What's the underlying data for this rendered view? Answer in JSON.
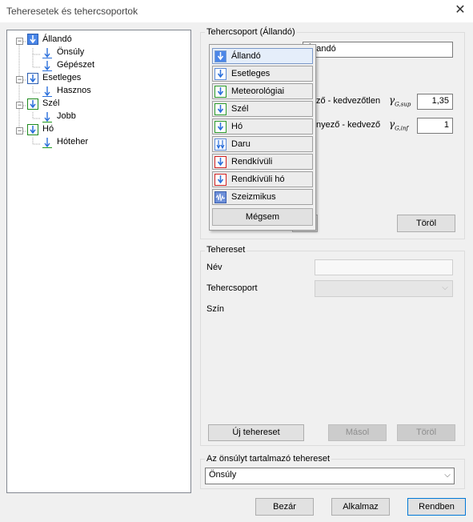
{
  "window": {
    "title": "Teheresetek és tehercsoportok"
  },
  "tree": {
    "groups": [
      {
        "label": "Állandó",
        "icon_color": "#3a7bd5",
        "children": [
          "Önsúly",
          "Gépészet"
        ]
      },
      {
        "label": "Esetleges",
        "icon_color": "#3a7bd5",
        "children": [
          "Hasznos"
        ]
      },
      {
        "label": "Szél",
        "icon_color": "#2aa02a",
        "children": [
          "Jobb"
        ]
      },
      {
        "label": "Hó",
        "icon_color": "#2aa02a",
        "children": [
          "Hóteher"
        ]
      }
    ]
  },
  "loadgroup": {
    "title": "Tehercsoport (Állandó)",
    "name_value": "Állandó",
    "unfav_label": "ző - kedvezőtlen",
    "unfav_symbol": "γG,sup",
    "unfav_value": "1,35",
    "fav_label": "nyező - kedvező",
    "fav_symbol": "γG,inf",
    "fav_value": "1",
    "delete_label": "Töröl"
  },
  "popup": {
    "items": [
      {
        "label": "Állandó",
        "icon": "arrow-down-blue-icon"
      },
      {
        "label": "Esetleges",
        "icon": "arrow-down-blue-icon"
      },
      {
        "label": "Meteorológiai",
        "icon": "arrow-down-green-icon"
      },
      {
        "label": "Szél",
        "icon": "arrow-down-green-icon"
      },
      {
        "label": "Hó",
        "icon": "arrow-down-green-icon"
      },
      {
        "label": "Daru",
        "icon": "double-arrow-down-icon"
      },
      {
        "label": "Rendkívüli",
        "icon": "arrow-down-red-icon"
      },
      {
        "label": "Rendkívüli hó",
        "icon": "arrow-down-red-icon"
      },
      {
        "label": "Szeizmikus",
        "icon": "seismic-icon"
      }
    ],
    "cancel_label": "Mégsem"
  },
  "loadcase": {
    "title": "Tehereset",
    "name_label": "Név",
    "name_value": "",
    "group_label": "Tehercsoport",
    "group_value": "",
    "color_label": "Szín",
    "new_label": "Új tehereset",
    "copy_label": "Másol",
    "delete_label": "Töröl"
  },
  "selfweight": {
    "title": "Az önsúlyt tartalmazó tehereset",
    "value": "Önsúly"
  },
  "footer": {
    "close_label": "Bezár",
    "apply_label": "Alkalmaz",
    "ok_label": "Rendben"
  }
}
